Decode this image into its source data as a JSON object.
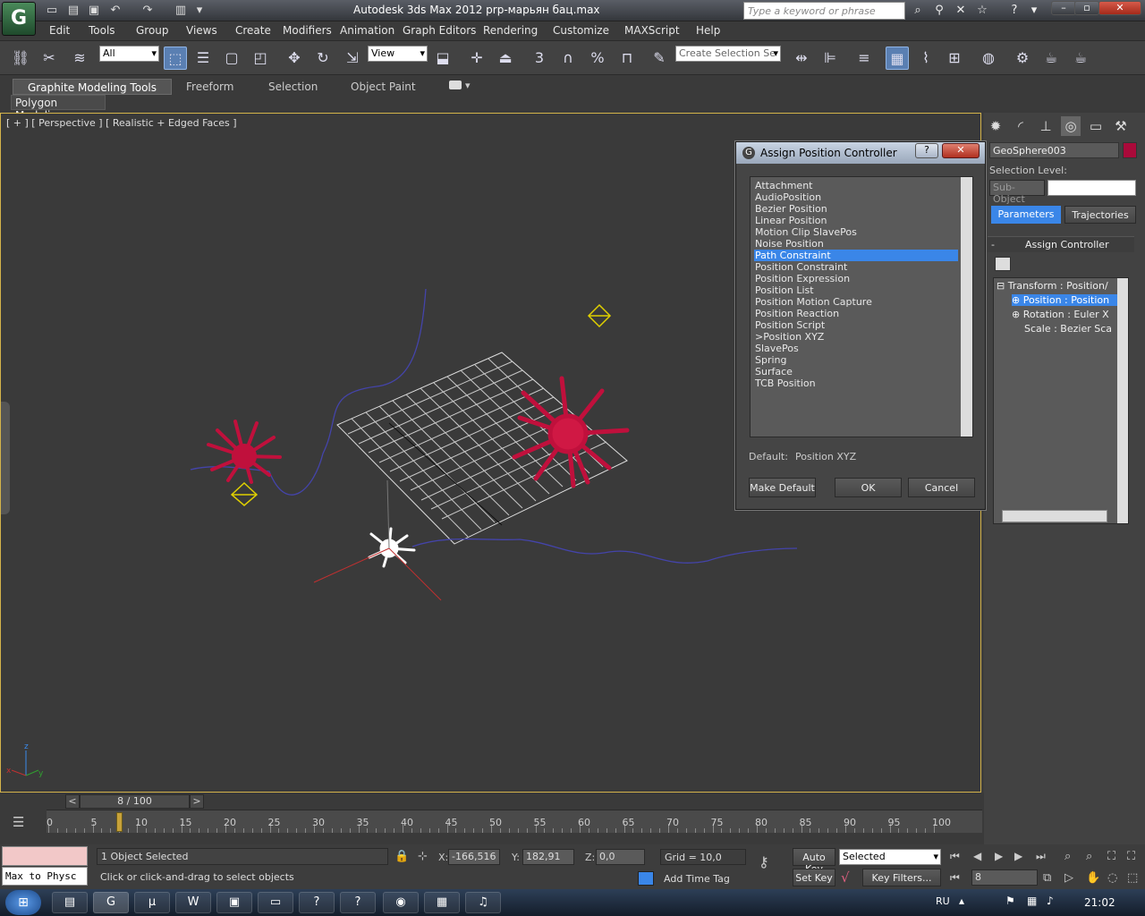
{
  "window": {
    "title": "Autodesk 3ds Max  2012    prp-марьян бац.max",
    "search_placeholder": "Type a keyword or phrase",
    "quick_access": [
      "new-file-icon",
      "open-icon",
      "save-icon",
      "undo-icon",
      "redo-icon",
      "project-icon"
    ]
  },
  "menu": [
    "Edit",
    "Tools",
    "Group",
    "Views",
    "Create",
    "Modifiers",
    "Animation",
    "Graph Editors",
    "Rendering",
    "Customize",
    "MAXScript",
    "Help"
  ],
  "toolbar": {
    "selection_filter": "All",
    "ref_coord": "View",
    "named_selection": "Create Selection Se",
    "snap_labels": [
      "3",
      "%"
    ]
  },
  "ribbon": {
    "tabs": [
      "Graphite Modeling Tools",
      "Freeform",
      "Selection",
      "Object Paint"
    ],
    "panel": "Polygon Modeling"
  },
  "viewport": {
    "label": "[ + ] [ Perspective ] [ Realistic + Edged Faces ]",
    "axis_labels": [
      "z",
      "x",
      "y"
    ]
  },
  "command_panel": {
    "object_name": "GeoSphere003",
    "selection_level_label": "Selection Level:",
    "sub_object_label": "Sub-Object",
    "tabs": [
      "Parameters",
      "Trajectories"
    ],
    "rollout": "Assign Controller",
    "tree": [
      "Transform : Position/",
      "Position : Position",
      "Rotation : Euler X",
      "Scale : Bezier Sca"
    ]
  },
  "dialog": {
    "title": "Assign Position Controller",
    "items": [
      "Attachment",
      "AudioPosition",
      "Bezier Position",
      "Linear Position",
      "Motion Clip SlavePos",
      "Noise Position",
      "Path Constraint",
      "Position Constraint",
      "Position Expression",
      "Position List",
      "Position Motion Capture",
      "Position Reaction",
      "Position Script",
      ">Position XYZ",
      "SlavePos",
      "Spring",
      "Surface",
      "TCB Position"
    ],
    "selected_index": 6,
    "default_label": "Default:",
    "default_value": "Position XYZ",
    "make_default": "Make Default",
    "ok": "OK",
    "cancel": "Cancel"
  },
  "timeline": {
    "frame_display": "8 / 100",
    "current_frame": 8,
    "ticks": [
      "0",
      "5",
      "10",
      "15",
      "20",
      "25",
      "30",
      "35",
      "40",
      "45",
      "50",
      "55",
      "60",
      "65",
      "70",
      "75",
      "80",
      "85",
      "90",
      "95",
      "100"
    ]
  },
  "status": {
    "selected": "1 Object Selected",
    "prompt": "Click or click-and-drag to select objects",
    "maxscript": "Max to Physc",
    "x_label": "X:",
    "x": "-166,516",
    "y_label": "Y:",
    "y": "182,91",
    "z_label": "Z:",
    "z": "0,0",
    "grid": "Grid = 10,0",
    "add_time_tag": "Add Time Tag",
    "auto_key": "Auto Key",
    "set_key": "Set Key",
    "key_mode": "Selected",
    "key_filters": "Key Filters...",
    "frame_field": "8"
  },
  "taskbar": {
    "lang": "RU",
    "clock": "21:02",
    "apps": [
      "W",
      "?",
      "?"
    ]
  },
  "colors": {
    "selection_highlight": "#3a86e8",
    "object_red": "#c0103c",
    "viewport_border": "#d4b34a",
    "path_blue": "#4a4ab0"
  }
}
